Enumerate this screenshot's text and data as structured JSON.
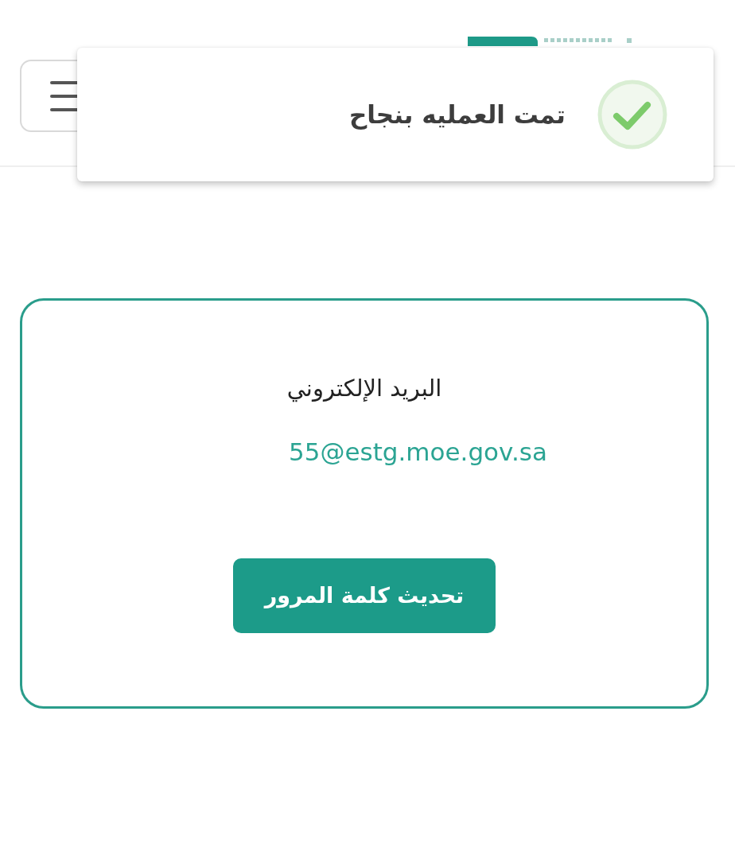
{
  "toast": {
    "success": true,
    "message": "تمت العمليه بنجاح"
  },
  "account_card": {
    "label": "البريد الإلكتروني",
    "email": "55@estg.moe.gov.sa",
    "button": "تحديث كلمة المرور"
  }
}
